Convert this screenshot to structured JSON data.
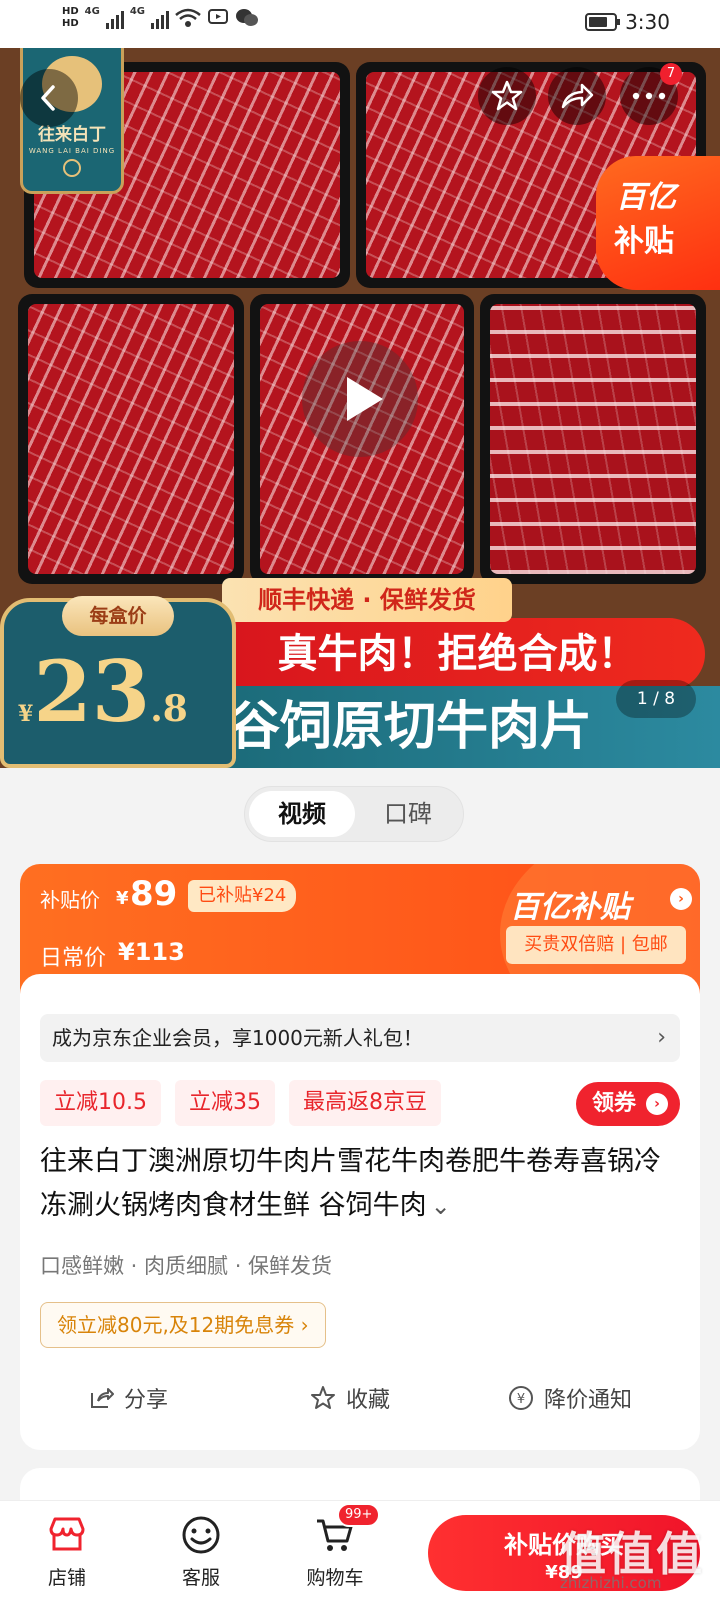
{
  "status_bar": {
    "time": "3:30",
    "network_1": "HD",
    "network_2": "HD",
    "signal_1": "4G",
    "signal_2": "4G"
  },
  "hero": {
    "logo_text": "往来白丁",
    "logo_sub": "WANG LAI BAI DING",
    "cart_badge_count": "7",
    "subsidy_line1": "百亿",
    "subsidy_line2": "补贴",
    "banner_top": "顺丰快递 · 保鲜发货",
    "banner_mid": "真牛肉！拒绝合成！",
    "banner_bottom": "谷饲原切牛肉片",
    "price_tag": "每盒价",
    "price_currency": "¥",
    "price_integer": "23",
    "price_decimal": ".8",
    "pager": "1 / 8"
  },
  "media_switch": {
    "tabs": [
      "视频",
      "口碑"
    ]
  },
  "price_card": {
    "subsidy_label": "补贴价",
    "currency": "¥",
    "subsidy_price": "89",
    "saved": "已补贴¥24",
    "daily_label": "日常价",
    "daily_price": "¥113",
    "brand": "百亿补贴",
    "brand_arrow": "›",
    "guarantee": "买贵双倍赔 | 包邮"
  },
  "info": {
    "member_text": "成为京东企业会员，享1000元新人礼包！",
    "member_arrow": "›",
    "chips": [
      "立减10.5",
      "立减35",
      "最高返8京豆"
    ],
    "coupon_label": "领券",
    "coupon_arrow": "›",
    "title": "往来白丁澳洲原切牛肉片雪花牛肉卷肥牛卷寿喜锅冷冻涮火锅烤肉食材生鲜 谷饲牛肉",
    "title_chevron": "⌄",
    "features": "口感鲜嫩 · 肉质细腻 · 保鲜发货",
    "promo": "领立减80元,及12期免息券 ›",
    "actions": [
      "分享",
      "收藏",
      "降价通知"
    ]
  },
  "bottom_nav": {
    "items": [
      "店铺",
      "客服",
      "购物车"
    ],
    "cart_badge": "99+",
    "buy_label": "补贴价购买",
    "buy_price": "¥89"
  },
  "watermark": {
    "main": "值值值",
    "sub": "zhizhizhi.com"
  },
  "colors": {
    "accent_red": "#f0232e",
    "subsidy_orange": "#ff5a1a",
    "hero_teal": "#1c5d6c"
  }
}
